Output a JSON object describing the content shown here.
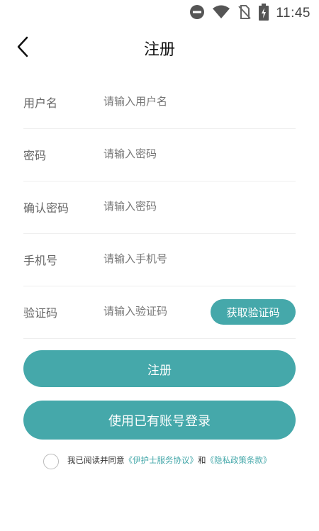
{
  "status_bar": {
    "time": "11:45"
  },
  "header": {
    "title": "注册"
  },
  "form": {
    "rows": [
      {
        "label": "用户名",
        "placeholder": "请输入用户名"
      },
      {
        "label": "密码",
        "placeholder": "请输入密码"
      },
      {
        "label": "确认密码",
        "placeholder": "请输入密码"
      },
      {
        "label": "手机号",
        "placeholder": "请输入手机号"
      },
      {
        "label": "验证码",
        "placeholder": "请输入验证码"
      }
    ],
    "get_code_label": "获取验证码"
  },
  "buttons": {
    "register": "注册",
    "login_existing": "使用已有账号登录"
  },
  "agreement": {
    "prefix": "我已阅读并同意",
    "service_link": "《伊护士服务协议》",
    "conjunction": "和",
    "privacy_link": "《隐私政策条款》"
  },
  "colors": {
    "accent": "#45a8aa"
  },
  "icons": [
    "do-not-disturb-icon",
    "wifi-icon",
    "no-sim-icon",
    "battery-charging-icon",
    "back-arrow-icon"
  ]
}
